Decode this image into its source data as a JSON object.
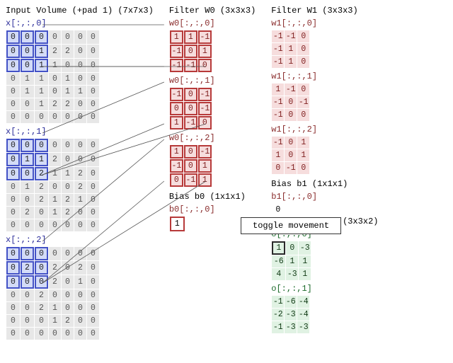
{
  "input": {
    "title": "Input Volume (+pad 1) (7x7x3)",
    "highlight": {
      "r0": 0,
      "r1": 2,
      "c0": 0,
      "c1": 2
    },
    "slices": [
      {
        "label": "x[:,:,0]",
        "rows": [
          [
            0,
            0,
            0,
            0,
            0,
            0,
            0
          ],
          [
            0,
            0,
            1,
            2,
            2,
            0,
            0
          ],
          [
            0,
            0,
            1,
            1,
            0,
            0,
            0
          ],
          [
            0,
            1,
            1,
            0,
            1,
            0,
            0
          ],
          [
            0,
            1,
            1,
            0,
            1,
            1,
            0
          ],
          [
            0,
            0,
            1,
            2,
            2,
            0,
            0
          ],
          [
            0,
            0,
            0,
            0,
            0,
            0,
            0
          ]
        ]
      },
      {
        "label": "x[:,:,1]",
        "rows": [
          [
            0,
            0,
            0,
            0,
            0,
            0,
            0
          ],
          [
            0,
            1,
            1,
            2,
            0,
            0,
            0
          ],
          [
            0,
            0,
            2,
            1,
            1,
            2,
            0
          ],
          [
            0,
            1,
            2,
            0,
            0,
            2,
            0
          ],
          [
            0,
            0,
            2,
            1,
            2,
            1,
            0
          ],
          [
            0,
            2,
            0,
            1,
            2,
            0,
            0
          ],
          [
            0,
            0,
            0,
            0,
            0,
            0,
            0
          ]
        ]
      },
      {
        "label": "x[:,:,2]",
        "rows": [
          [
            0,
            0,
            0,
            0,
            0,
            0,
            0
          ],
          [
            0,
            2,
            0,
            2,
            0,
            2,
            0
          ],
          [
            0,
            0,
            0,
            2,
            0,
            1,
            0
          ],
          [
            0,
            0,
            2,
            0,
            0,
            0,
            0
          ],
          [
            0,
            0,
            2,
            1,
            0,
            0,
            0
          ],
          [
            0,
            0,
            0,
            1,
            2,
            0,
            0
          ],
          [
            0,
            0,
            0,
            0,
            0,
            0,
            0
          ]
        ]
      }
    ]
  },
  "filter0": {
    "title": "Filter W0 (3x3x3)",
    "slices": [
      {
        "label": "w0[:,:,0]",
        "rows": [
          [
            1,
            1,
            -1
          ],
          [
            -1,
            0,
            1
          ],
          [
            -1,
            -1,
            0
          ]
        ]
      },
      {
        "label": "w0[:,:,1]",
        "rows": [
          [
            -1,
            0,
            -1
          ],
          [
            0,
            0,
            -1
          ],
          [
            1,
            -1,
            0
          ]
        ]
      },
      {
        "label": "w0[:,:,2]",
        "rows": [
          [
            1,
            0,
            -1
          ],
          [
            -1,
            0,
            1
          ],
          [
            0,
            -1,
            1
          ]
        ]
      }
    ],
    "bias_title": "Bias b0 (1x1x1)",
    "bias_label": "b0[:,:,0]",
    "bias": 1
  },
  "filter1": {
    "title": "Filter W1 (3x3x3)",
    "slices": [
      {
        "label": "w1[:,:,0]",
        "rows": [
          [
            -1,
            -1,
            0
          ],
          [
            -1,
            1,
            0
          ],
          [
            -1,
            1,
            0
          ]
        ]
      },
      {
        "label": "w1[:,:,1]",
        "rows": [
          [
            1,
            -1,
            0
          ],
          [
            -1,
            0,
            -1
          ],
          [
            -1,
            0,
            0
          ]
        ]
      },
      {
        "label": "w1[:,:,2]",
        "rows": [
          [
            -1,
            0,
            1
          ],
          [
            1,
            0,
            1
          ],
          [
            0,
            -1,
            0
          ]
        ]
      }
    ],
    "bias_title": "Bias b1 (1x1x1)",
    "bias_label": "b1[:,:,0]",
    "bias": 0
  },
  "output": {
    "title": "Output Volume (3x3x2)",
    "highlight": {
      "slice": 0,
      "r": 0,
      "c": 0
    },
    "slices": [
      {
        "label": "o[:,:,0]",
        "rows": [
          [
            1,
            0,
            -3
          ],
          [
            -6,
            1,
            1
          ],
          [
            4,
            -3,
            1
          ]
        ]
      },
      {
        "label": "o[:,:,1]",
        "rows": [
          [
            -1,
            -6,
            -4
          ],
          [
            -2,
            -3,
            -4
          ],
          [
            -1,
            -3,
            -3
          ]
        ]
      }
    ]
  },
  "toggle_label": "toggle movement"
}
